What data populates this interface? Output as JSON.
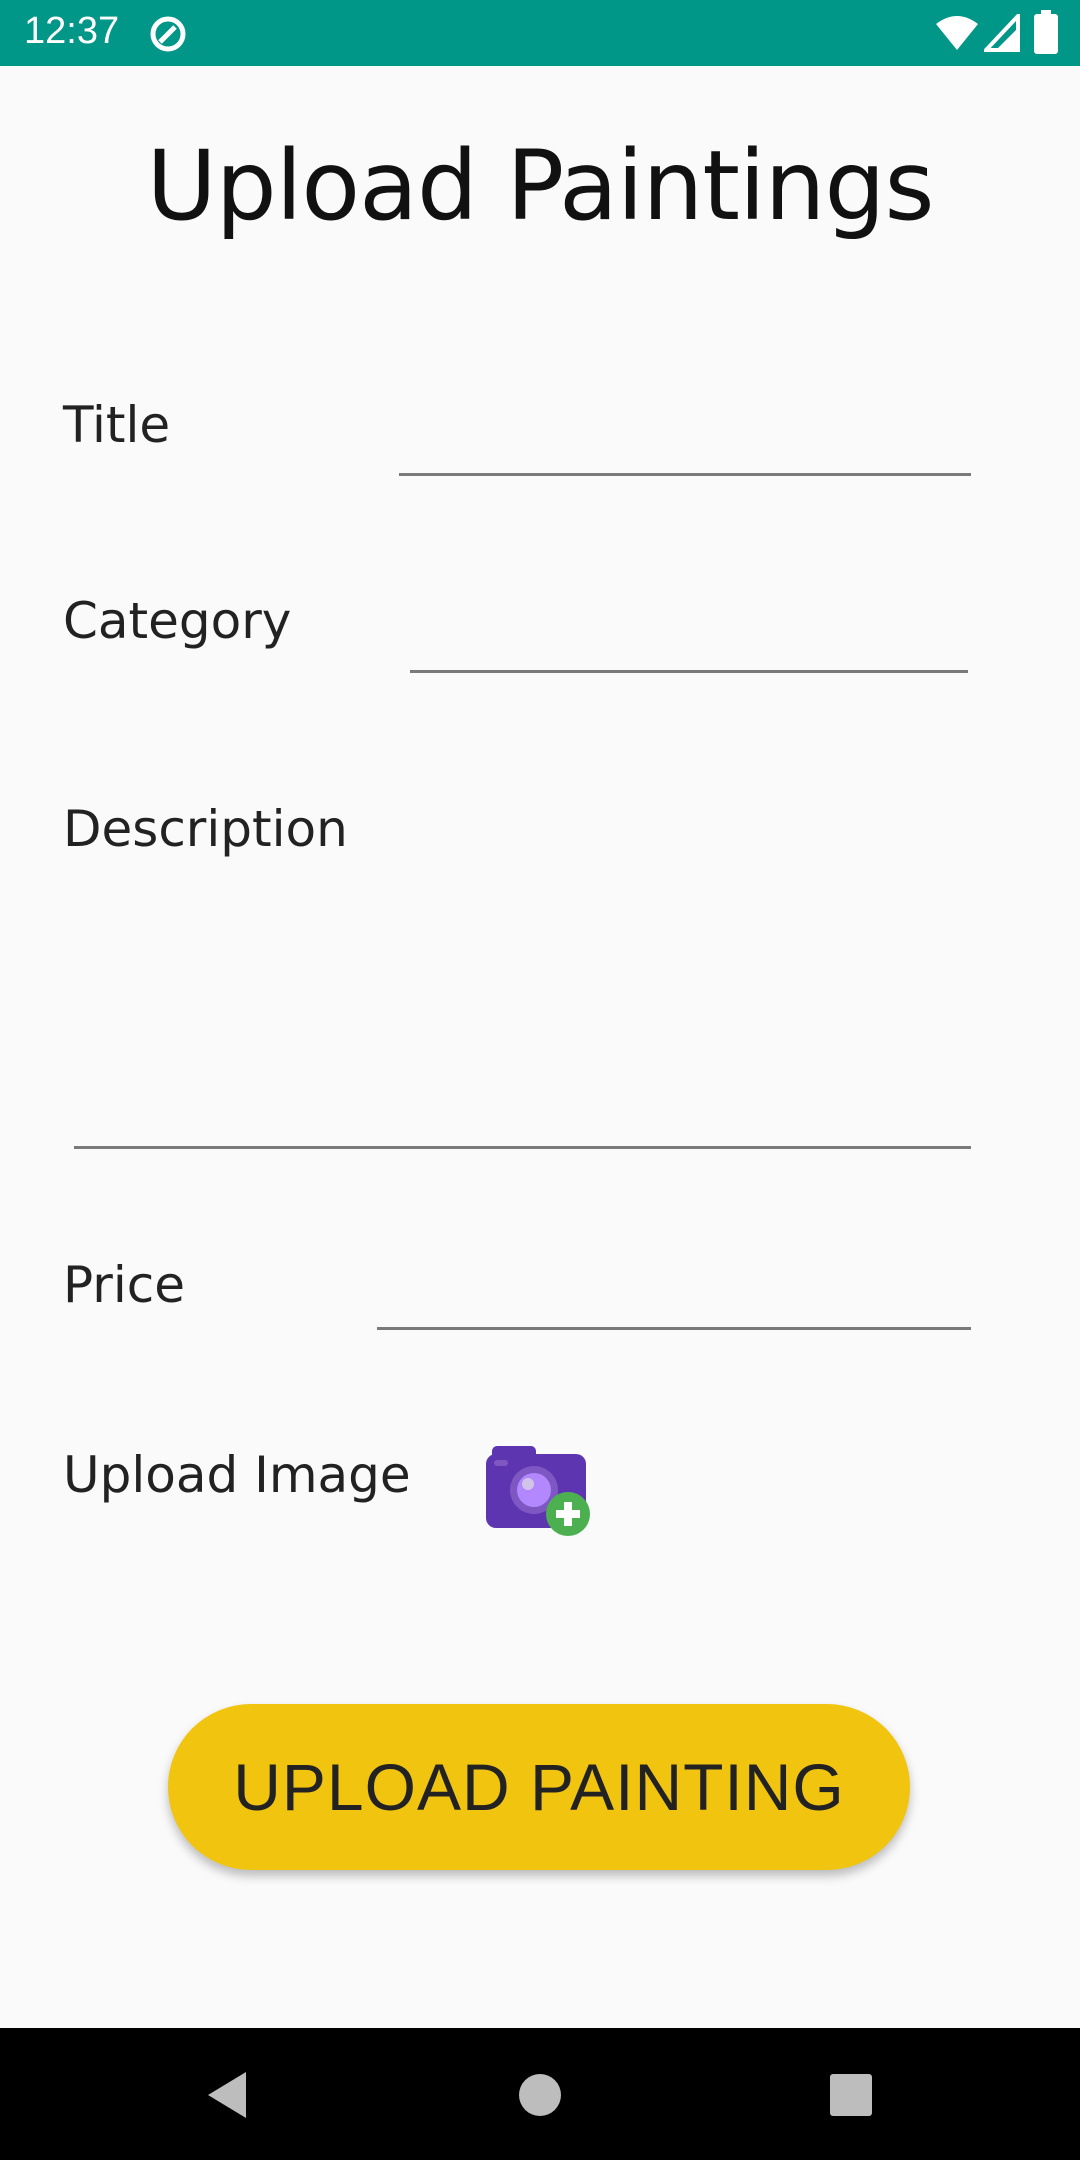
{
  "status_bar": {
    "time": "12:37",
    "icons": [
      "notification-app-icon",
      "wifi-icon",
      "signal-icon",
      "battery-icon"
    ],
    "background": "#009688"
  },
  "page": {
    "title": "Upload Paintings"
  },
  "form": {
    "title_label": "Title",
    "title_value": "",
    "category_label": "Category",
    "category_value": "",
    "description_label": "Description",
    "description_value": "",
    "price_label": "Price",
    "price_value": "",
    "upload_image_label": "Upload Image",
    "camera_icon": "add-photo-camera-icon"
  },
  "actions": {
    "upload_button_label": "UPLOAD PAINTING",
    "upload_button_color": "#F1C40F"
  },
  "nav_bar": {
    "icons": [
      "back-icon",
      "home-icon",
      "recents-icon"
    ]
  }
}
